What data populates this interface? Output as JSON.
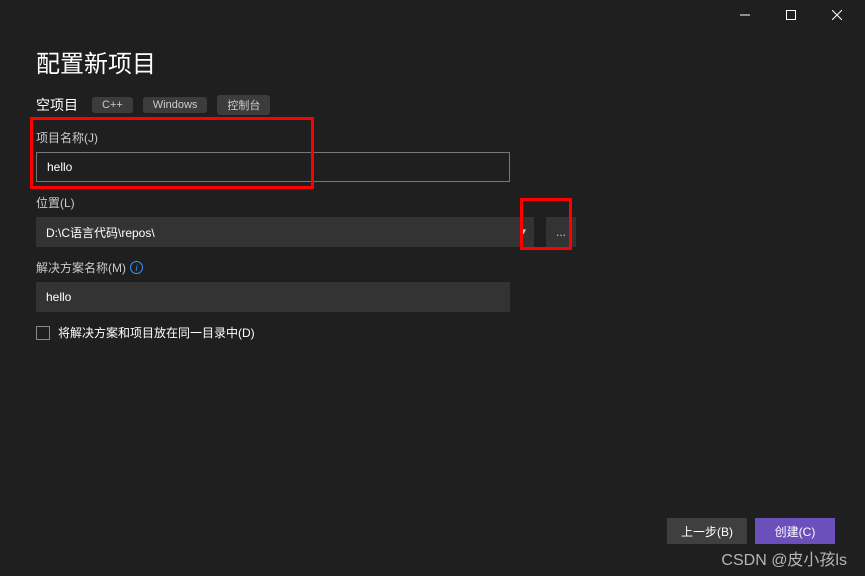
{
  "window": {
    "title": "配置新项目",
    "subtitle": "空项目",
    "tags": [
      "C++",
      "Windows",
      "控制台"
    ]
  },
  "fields": {
    "projectName": {
      "label": "项目名称(J)",
      "value": "hello"
    },
    "location": {
      "label": "位置(L)",
      "value": "D:\\C语言代码\\repos\\"
    },
    "solutionName": {
      "label": "解决方案名称(M)",
      "value": "hello"
    },
    "sameDir": {
      "label": "将解决方案和项目放在同一目录中(D)",
      "checked": false
    }
  },
  "buttons": {
    "back": "上一步(B)",
    "create": "创建(C)",
    "browse": "..."
  },
  "watermark": "CSDN @皮小孩ls"
}
